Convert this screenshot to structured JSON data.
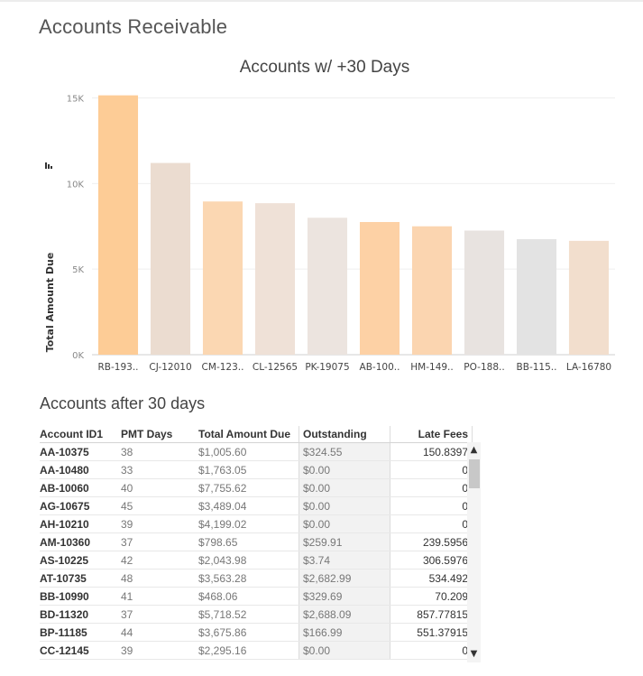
{
  "page": {
    "title": "Accounts Receivable"
  },
  "chart_data": {
    "type": "bar",
    "title": "Accounts w/ +30 Days",
    "xlabel": "",
    "ylabel": "Total Amount Due",
    "ylim": [
      0,
      15500
    ],
    "yticks": [
      {
        "value": 0,
        "label": "0K"
      },
      {
        "value": 5000,
        "label": "5K"
      },
      {
        "value": 10000,
        "label": "10K"
      },
      {
        "value": 15000,
        "label": "15K"
      }
    ],
    "grid": true,
    "categories": [
      "RB-193..",
      "CJ-12010",
      "CM-123..",
      "CL-12565",
      "PK-19075",
      "AB-100..",
      "HM-149..",
      "PO-188..",
      "BB-115..",
      "LA-16780"
    ],
    "values": [
      15150,
      11200,
      8950,
      8850,
      8000,
      7750,
      7500,
      7250,
      6750,
      6650
    ],
    "colors": [
      "#fdcc96",
      "#ebdcd0",
      "#fbd7b2",
      "#efe1d7",
      "#ece4df",
      "#fdd1a5",
      "#fbd5b0",
      "#e8e3e0",
      "#e3e3e3",
      "#f2decd"
    ]
  },
  "table": {
    "title": "Accounts after 30 days",
    "headers": [
      "Account ID1",
      "PMT Days",
      "Total Amount Due",
      "Outstanding",
      "Late Fees"
    ],
    "rows": [
      [
        "AA-10375",
        "38",
        "$1,005.60",
        "$324.55",
        "150.8397"
      ],
      [
        "AA-10480",
        "33",
        "$1,763.05",
        "$0.00",
        "0"
      ],
      [
        "AB-10060",
        "40",
        "$7,755.62",
        "$0.00",
        "0"
      ],
      [
        "AG-10675",
        "45",
        "$3,489.04",
        "$0.00",
        "0"
      ],
      [
        "AH-10210",
        "39",
        "$4,199.02",
        "$0.00",
        "0"
      ],
      [
        "AM-10360",
        "37",
        "$798.65",
        "$259.91",
        "239.5956"
      ],
      [
        "AS-10225",
        "42",
        "$2,043.98",
        "$3.74",
        "306.5976"
      ],
      [
        "AT-10735",
        "48",
        "$3,563.28",
        "$2,682.99",
        "534.492"
      ],
      [
        "BB-10990",
        "41",
        "$468.06",
        "$329.69",
        "70.209"
      ],
      [
        "BD-11320",
        "37",
        "$5,718.52",
        "$2,688.09",
        "857.77815"
      ],
      [
        "BP-11185",
        "44",
        "$3,675.86",
        "$166.99",
        "551.37915"
      ],
      [
        "CC-12145",
        "39",
        "$2,295.16",
        "$0.00",
        "0"
      ]
    ]
  },
  "scrollbar": {
    "up": "▲",
    "down": "▼"
  },
  "icons": {
    "sort": "sort-icon"
  }
}
